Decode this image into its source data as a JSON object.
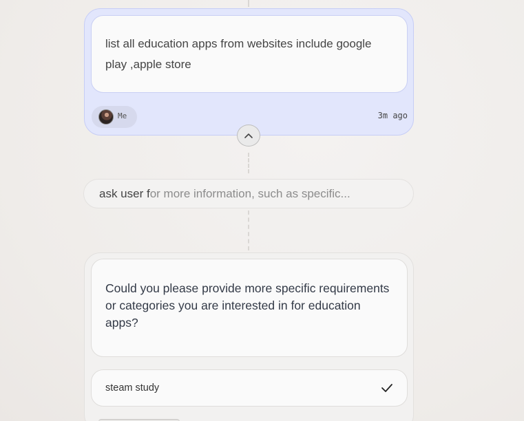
{
  "user_message": {
    "text": "list all education apps  from websites include google play ,apple store",
    "author": "Me",
    "time": "3m ago",
    "collapse_icon": "chevron-up-icon"
  },
  "step": {
    "text_dark": "ask user f",
    "text_fade": "or more information, such as specific..."
  },
  "question": {
    "text": "Could you please provide more specific requirements or categories you are interested in for education apps?",
    "answer": "steam study",
    "answer_icon": "check-icon"
  },
  "colors": {
    "user_card_bg": "#e2e6fc",
    "user_card_border": "#c6cdf6",
    "text_primary": "#333a47"
  }
}
